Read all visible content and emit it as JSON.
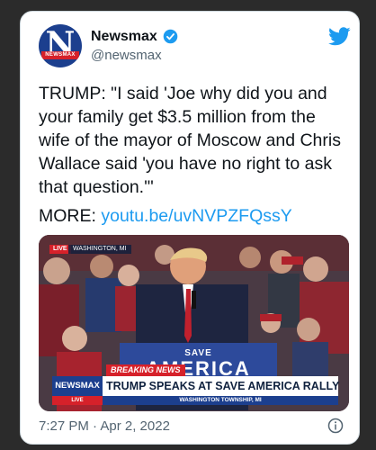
{
  "account": {
    "name": "Newsmax",
    "handle": "@newsmax",
    "avatar_letter": "N",
    "avatar_strip": "NEWSMAX"
  },
  "tweet": {
    "text": "TRUMP: \"I said 'Joe why did you and your family get $3.5 million from the wife of the mayor of Moscow and Chris Wallace said 'you have no right to ask that question.'\"",
    "more_label": "MORE:",
    "link": "youtu.be/uvNVPZFQssY",
    "timestamp": "7:27 PM · Apr 2, 2022"
  },
  "media": {
    "live_tag": "LIVE",
    "location_tag": "WASHINGTON, MI",
    "podium_line1": "SAVE",
    "podium_line2": "AMERICA",
    "breaking_label": "BREAKING NEWS",
    "network_logo": "NEWSMAX",
    "headline": "TRUMP SPEAKS AT SAVE AMERICA RALLY",
    "live_small": "LIVE",
    "subline": "WASHINGTON TOWNSHIP, MI"
  },
  "icons": {
    "verified": "verified-badge-icon",
    "bird": "twitter-bird-icon",
    "info": "info-icon"
  },
  "colors": {
    "link": "#1d9bf0",
    "verified": "#1d9bf0",
    "newsmax_blue": "#1c3f8e",
    "breaking_red": "#d6212a"
  }
}
